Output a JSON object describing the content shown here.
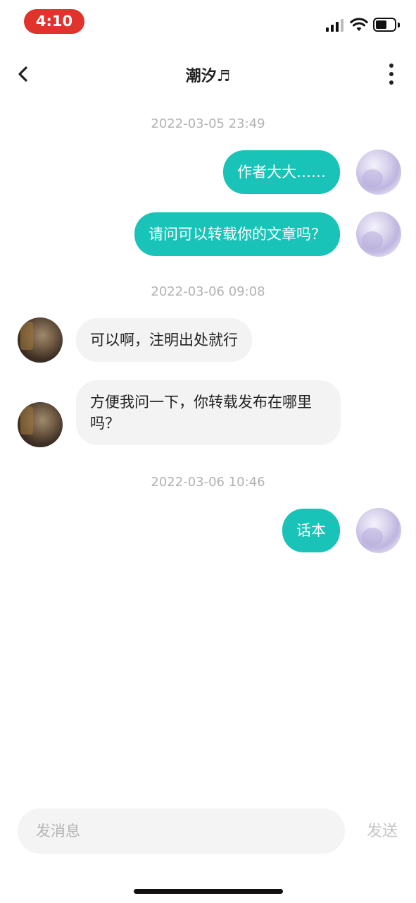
{
  "status_bar": {
    "time": "4:10",
    "time_pill_color": "#e0332e",
    "icons": [
      "signal-icon",
      "wifi-icon",
      "battery-icon"
    ]
  },
  "nav": {
    "title": "潮汐♬",
    "back_icon": "chevron-left-icon",
    "more_icon": "more-vertical-icon"
  },
  "messages": {
    "timestamps": [
      "2022-03-05 23:49",
      "2022-03-06 09:08",
      "2022-03-06 10:46"
    ],
    "items": [
      {
        "sender": "me",
        "text": "作者大大……"
      },
      {
        "sender": "me",
        "text": "请问可以转载你的文章吗？"
      },
      {
        "sender": "other",
        "text": "可以啊，注明出处就行"
      },
      {
        "sender": "other",
        "text": "方便我问一下，你转载发布在哪里吗？"
      },
      {
        "sender": "me",
        "text": "话本"
      }
    ]
  },
  "composer": {
    "placeholder": "发消息",
    "value": "",
    "send_label": "发送"
  },
  "colors": {
    "accent": "#19c3b8",
    "incoming_bubble": "#f3f3f3",
    "timestamp": "#b2b2b2"
  }
}
